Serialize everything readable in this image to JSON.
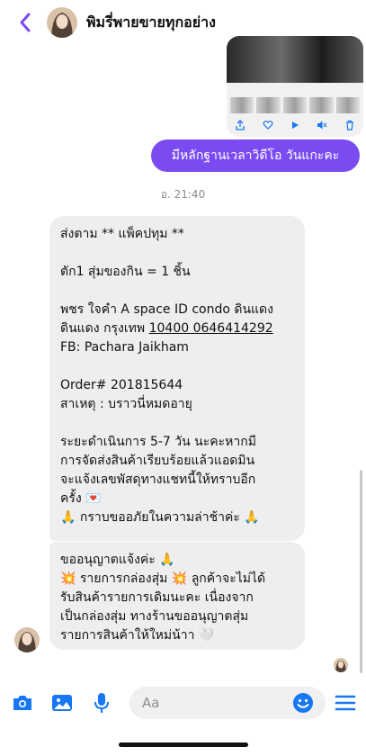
{
  "header": {
    "title": "พิมรี่พายขายทุกอย่าง",
    "back_icon": "chevron-left-icon"
  },
  "colors": {
    "accent": "#7b4bf2",
    "bubble_received": "#eeeeee",
    "icon_blue": "#1877f2"
  },
  "thread": {
    "sent_message": "มีหลักฐานเวลาวิดีโอ วันแกะคะ",
    "timestamp": "อ. 21:40",
    "received_1": {
      "l1": "ส่งตาม ** แพ็คปทุม **",
      "l2": "ตัก1 สุ่มของกิน = 1 ชิ้น",
      "l3": "พชร ใจคำ A space ID condo ดินแดง",
      "l4a": "ดินแดง กรุงเทพ ",
      "l4b": "10400 0646414292",
      "l5": "FB: Pachara Jaikham",
      "l6": "Order# 201815644",
      "l7": "สาเหตุ : บราวนี่หมดอายุ",
      "l8": "ระยะดำเนินการ 5-7 วัน นะคะหากมี",
      "l9": "การจัดส่งสินค้าเรียบร้อยแล้วแอดมิน",
      "l10": "จะแจ้งเลขพัสดุทางแชทนี้ให้ทราบอีก",
      "l11": "ครั้ง 💌",
      "l12": "🙏 กราบขออภัยในความล่าช้าค่ะ 🙏"
    },
    "received_2": {
      "l1": "ขออนุญาตแจ้งค่ะ 🙏",
      "l2": "💥 รายการกล่องสุ่ม 💥 ลูกค้าจะไม่ได้",
      "l3": "รับสินค้ารายการเดิมนะคะ เนื่องจาก",
      "l4": "เป็นกล่องสุ่ม ทางร้านขออนุญาตสุ่ม",
      "l5": "รายการสินค้าให้ใหม่น้าา 🤍"
    }
  },
  "composer": {
    "placeholder": "Aa",
    "icons": [
      "camera-icon",
      "gallery-icon",
      "microphone-icon",
      "emoji-icon",
      "menu-icon"
    ]
  }
}
